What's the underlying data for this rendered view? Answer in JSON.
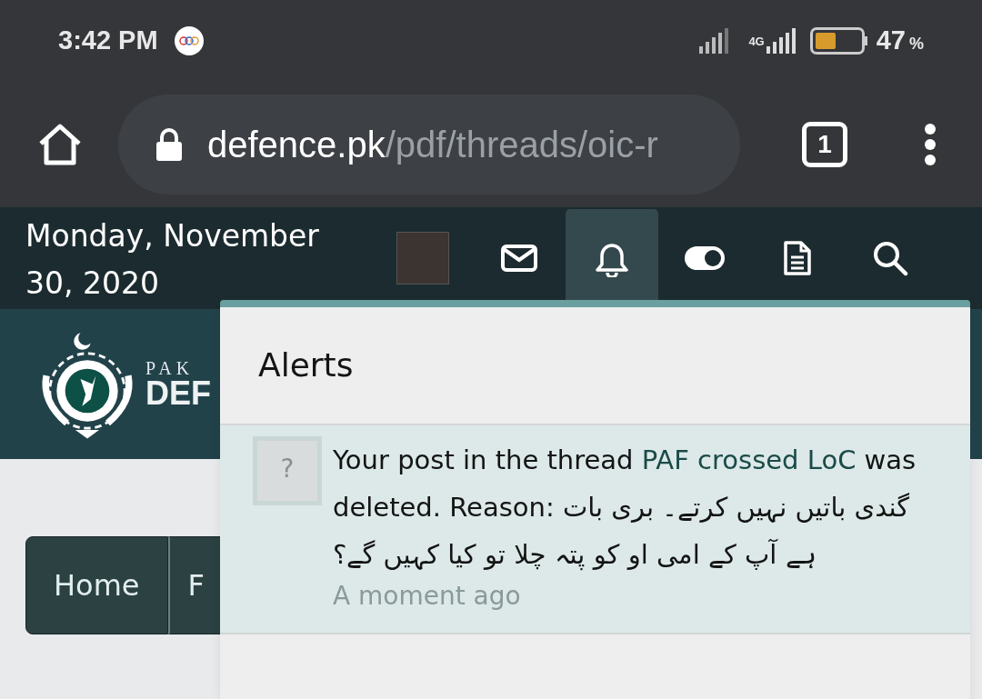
{
  "status_bar": {
    "time": "3:42 PM",
    "network": "4G",
    "battery": {
      "level": 0.47
    },
    "battery_percent": "47",
    "percent_sign": "%"
  },
  "browser": {
    "url_host": "defence.pk",
    "url_path": "/pdf/threads/oic-r",
    "tab_count": "1"
  },
  "site_header": {
    "date": "Monday, November 30, 2020",
    "nav": [
      {
        "kind": "avatar",
        "selected": false
      },
      {
        "kind": "mail",
        "selected": false
      },
      {
        "kind": "bell",
        "selected": true
      },
      {
        "kind": "toggle",
        "selected": false
      },
      {
        "kind": "document",
        "selected": false
      },
      {
        "kind": "search",
        "selected": false
      }
    ]
  },
  "banner": {
    "logo_line_1": "PAK",
    "logo_line_2": "DEF"
  },
  "breadcrumbs": [
    {
      "label": "Home"
    },
    {
      "label": "F"
    }
  ],
  "alerts_popup": {
    "title": "Alerts",
    "items": [
      {
        "avatar": "?",
        "prefix": "Your post in the thread",
        "link": "PAF crossed LoC",
        "suffix": "was deleted. Reason: گندی باتیں نہیں کرتے۔ بری بات ہے آپ کے امی او کو پتہ چلا تو کیا کہیں گے؟",
        "time": "A moment ago"
      }
    ]
  }
}
